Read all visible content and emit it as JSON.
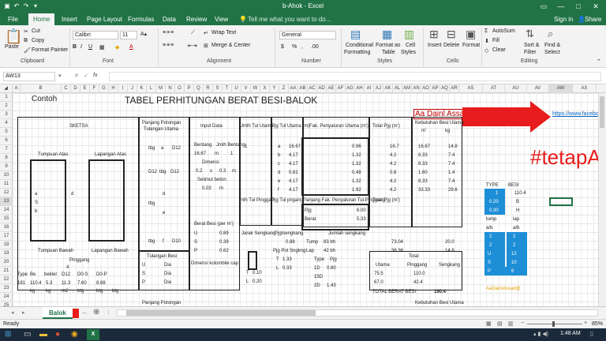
{
  "window": {
    "title": "b-Ahok - Excel"
  },
  "tabs": [
    "File",
    "Home",
    "Insert",
    "Page Layout",
    "Formulas",
    "Data",
    "Review",
    "View"
  ],
  "tell_me": "Tell me what you want to do...",
  "user": {
    "sign_in": "Sign in",
    "share": "Share"
  },
  "ribbon": {
    "clipboard": {
      "paste": "Paste",
      "cut": "Cut",
      "copy": "Copy",
      "format_painter": "Format Painter",
      "label": "Clipboard"
    },
    "font": {
      "name": "Calibri",
      "size": "11",
      "label": "Font",
      "bold": "B",
      "italic": "I",
      "underline": "U"
    },
    "alignment": {
      "wrap": "Wrap Text",
      "merge": "Merge & Center",
      "label": "Alignment"
    },
    "number": {
      "format": "General",
      "label": "Number",
      "currency": "$",
      "percent": "%"
    },
    "styles": {
      "conditional": "Conditional",
      "conditional2": "Formatting",
      "format_as": "Format as",
      "format_as2": "Table",
      "cell_styles": "Cell",
      "cell_styles2": "Styles",
      "label": "Styles"
    },
    "cells": {
      "insert": "Insert",
      "delete": "Delete",
      "format": "Format",
      "label": "Cells"
    },
    "editing": {
      "autosum": "AutoSum",
      "fill": "Fill",
      "clear": "Clear",
      "sort": "Sort &",
      "sort2": "Filter",
      "find": "Find &",
      "find2": "Select",
      "label": "Editing"
    }
  },
  "formula_bar": {
    "name_box": "AW13",
    "fx": "fx",
    "content": ""
  },
  "columns": [
    "A",
    "B",
    "C",
    "D",
    "E",
    "F",
    "G",
    "H",
    "I",
    "J",
    "K",
    "L",
    "M",
    "N",
    "O",
    "P",
    "Q",
    "R",
    "S",
    "T",
    "U",
    "V",
    "W",
    "X",
    "Y",
    "Z",
    "AA",
    "AB",
    "AC",
    "AD",
    "AE",
    "AF",
    "AG",
    "AH",
    "AI",
    "AJ",
    "AK",
    "AL",
    "AM",
    "AN",
    "AO",
    "AP",
    "AQ",
    "AR",
    "AS",
    "AT",
    "AU",
    "AV",
    "AW",
    "AX"
  ],
  "rows": [
    "1",
    "2",
    "3",
    "4",
    "5",
    "6",
    "7",
    "8",
    "9",
    "10",
    "11",
    "12",
    "13",
    "14",
    "15",
    "16",
    "17",
    "18",
    "19",
    "20",
    "21",
    "22",
    "23",
    "24",
    "25"
  ],
  "sheet": {
    "contoh": "Contoh",
    "main_title": "TABEL PERHITUNGAN BERAT BESI-BALOK",
    "author": "Aa Dainl Assad",
    "link": "https://www.facebo",
    "hashtag": "#tetapA",
    "sketsa": "SKETSA",
    "panjang_potongan": "Panjang Potongan",
    "tulangan_utama": "Tulangan Utama",
    "input_data": "Input Data",
    "jmlh_tul_utama": "Jmlh Tul Utama",
    "pjg_tul_utama": "Pjg Tul Utama (m)",
    "fak_penyaluran": "Fak. Penyaluran Utama (m')",
    "total_pjg": "Total Pjg (m')",
    "kebutuhan": "Kebutuhan Besi Utama",
    "m_unit": "m'",
    "kg_unit": "kg",
    "tumpuan_atas": "Tumpuan Atas",
    "lapangan_atas": "Lapangan Atas",
    "tumpuan_bawah": "Tumpuan Bawah",
    "lapangan_bawah": "Lapangan Bawah",
    "pinggang": "Pinggang",
    "bentang": "Bentang",
    "jmlh_bentang": "Jmlh Bentang",
    "dimensi": "Dimensi",
    "selimut": "Selimut beton",
    "v_1667": "16.67",
    "v_02": "0.2",
    "v_03": "0.3",
    "v_003": "0.03",
    "m": "m",
    "x": "x",
    "bentang_val": "1",
    "tbg": "tbg",
    "a": "a",
    "b": "b",
    "c": "c",
    "d": "d",
    "e": "e",
    "f": "f",
    "d12": "D12",
    "d10": "D10",
    "jml_tul_pinggang": "mlh Tul Pinggan",
    "pjg_tul_pngang": "Pjg Tul pngang",
    "panjang_fak_pinggang": "Panjang Fak. Penyaluran Tul.Pinggang",
    "total_pjg2": "Total Pjg (m')",
    "pjg": "Pjg",
    "berat": "Berat",
    "v_600": "6.00",
    "v_533": "5.33",
    "berat_besi": "Berat Besi (per m')",
    "v_089": "0.89",
    "v_039": "0.39",
    "v_062": "0.62",
    "jarak_sengkang": "Jarak Sengkang",
    "pjg_sengkang": "Pjgtsengkang",
    "jumlah_sengkang": "Jumlah sengkang",
    "tump": "Tump",
    "lap": "Lap",
    "v_83": "83 bh",
    "v_42": "42 bh",
    "pjg_pot_sngkng": "Pjg Pot Sngkng",
    "v_088": "0.88",
    "v_133": "1.33",
    "v_033": "0.33",
    "v_7304": "73.04",
    "v_3636": "36.36",
    "v_200": "20.0",
    "v_148": "14.8",
    "tulangan_besi": "Tulangan Besi",
    "u": "U",
    "s": "S",
    "p": "P",
    "dia": "Dia",
    "dim_kolom": "Dimensi kolombile cap",
    "type_pjg": "Type",
    "pjg_lbl": "Pjg",
    "v_1d": "1D",
    "v_15d": "15D",
    "v_2d": "2D",
    "v_080": "0.80",
    "v_143": "1.43",
    "v_010": "0.10",
    "v_020": "0.20",
    "v_t": "T",
    "v_l": "L",
    "utama": "Utama",
    "pinggang2": "Pinggang",
    "sengkang": "Sengkang",
    "total": "Total",
    "v_755": "75.5",
    "v_670": "67.0",
    "v_1100": "110.0",
    "v_424": "42.4",
    "total_berat": "TOTAL BERAT BESI",
    "v_1904": "190.4",
    "type": "Type",
    "bebesi": "Be Besi",
    "row21_vals": [
      "181",
      "110.4",
      "5.3",
      "11.3",
      "7.60",
      "8.88"
    ],
    "small_table": {
      "type": "TYPE",
      "besi": "BESI",
      "vals": [
        "1",
        "0.20",
        "0.30",
        "tump",
        "lap",
        "a/b",
        "2",
        "2",
        "12",
        "10",
        "6"
      ],
      "labels": [
        "B",
        "H",
        "a/b",
        "tump",
        "lap",
        "a/b",
        "2",
        "2",
        "U",
        "S",
        "P"
      ],
      "val2": [
        "110.4",
        "B",
        "H",
        "",
        "",
        "",
        "2",
        "2",
        "12",
        "10",
        "6"
      ]
    },
    "aa_dainl": "AaDainlAssad@",
    "v_4": "4",
    "vals_col": [
      "16.67",
      "4.17",
      "4.17",
      "0.81",
      "4.17",
      "4.17"
    ],
    "fak_vals": [
      "0.96",
      "1.32",
      "1.32",
      "0.48",
      "1.32",
      "1.92"
    ],
    "tot_vals": [
      "16.7",
      "4.2",
      "4.2",
      "0.8",
      "4.2",
      "4.2"
    ],
    "keb_m": [
      "16.67",
      "8.33",
      "8.33",
      "1.60",
      "8.33",
      "33.33"
    ],
    "keb_kg": [
      "14.8",
      "7.4",
      "7.4",
      "1.4",
      "7.4",
      "29.6"
    ],
    "row21_labels": [
      "Type",
      "Be",
      "bekler",
      "D12",
      "D0-S",
      "D0-P"
    ],
    "row23_units": [
      "kg",
      "kg",
      "m2",
      "btg",
      "btg",
      "btg"
    ]
  },
  "sheet_tabs": {
    "active": "Balok",
    "more": "..."
  },
  "status": {
    "ready": "Ready",
    "zoom": "85%"
  },
  "taskbar": {
    "time": "1:48 AM"
  }
}
